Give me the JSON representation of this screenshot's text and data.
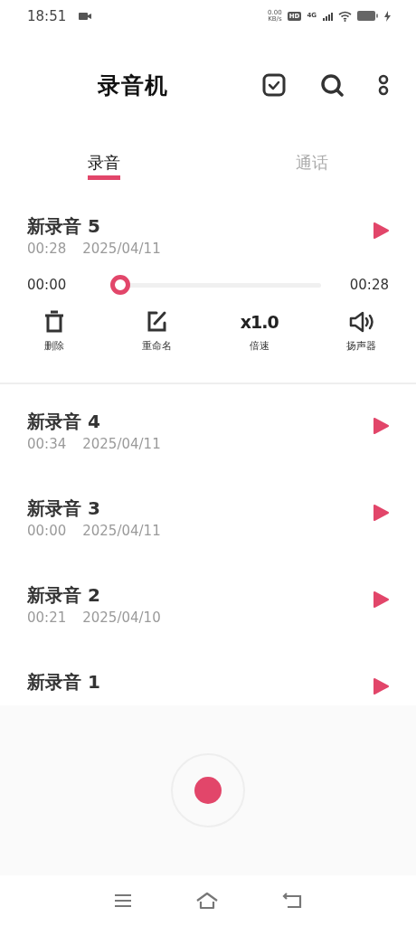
{
  "status_bar": {
    "time": "18:51",
    "speed": "0.00",
    "speed_unit": "KB/s",
    "hd": "HD",
    "network": "4G"
  },
  "header": {
    "title": "录音机"
  },
  "tabs": [
    {
      "label": "录音",
      "selected": true
    },
    {
      "label": "通话",
      "selected": false
    }
  ],
  "recordings": [
    {
      "name": "新录音 5",
      "duration": "00:28",
      "date": "2025/04/11",
      "expanded": true,
      "player": {
        "elapsed": "00:00",
        "total": "00:28",
        "level": 0,
        "actions": [
          {
            "kind": "delete",
            "label": "删除"
          },
          {
            "kind": "rename",
            "label": "重命名"
          },
          {
            "kind": "speed",
            "value": "x1.0",
            "label": "倍速"
          },
          {
            "kind": "speaker",
            "label": "扬声器"
          }
        ]
      }
    },
    {
      "name": "新录音 4",
      "duration": "00:34",
      "date": "2025/04/11",
      "expanded": false
    },
    {
      "name": "新录音 3",
      "duration": "00:00",
      "date": "2025/04/11",
      "expanded": false
    },
    {
      "name": "新录音 2",
      "duration": "00:21",
      "date": "2025/04/10",
      "expanded": false
    },
    {
      "name": "新录音 1",
      "expanded": false
    }
  ]
}
